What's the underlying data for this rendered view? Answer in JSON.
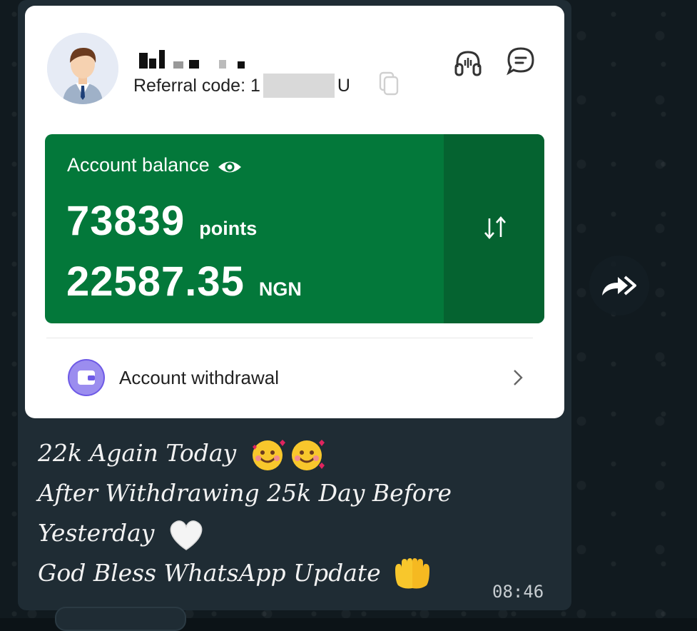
{
  "card": {
    "referral_label": "Referral code: 1",
    "referral_suffix": "U",
    "balance_label": "Account balance",
    "points_value": "73839",
    "points_unit": "points",
    "ngn_value": "22587.35",
    "ngn_unit": "NGN",
    "withdraw_label": "Account withdrawal"
  },
  "message": {
    "line1": "22k Again Today",
    "line2": "After Withdrawing 25k Day Before",
    "line3": "Yesterday",
    "line4": "God Bless WhatsApp Update",
    "time": "08:46"
  },
  "icons": {
    "headset": "headset-icon",
    "chat": "chat-icon",
    "copy": "copy-icon",
    "eye": "eye-icon",
    "transfer": "transfer-icon",
    "wallet": "wallet-icon",
    "chevron": "chevron-right-icon",
    "forward": "forward-icon"
  },
  "colors": {
    "balance_bg": "#03783a",
    "balance_side": "#056330",
    "wallet_accent": "#6e5ae6",
    "chat_bubble": "#1f2c34"
  }
}
